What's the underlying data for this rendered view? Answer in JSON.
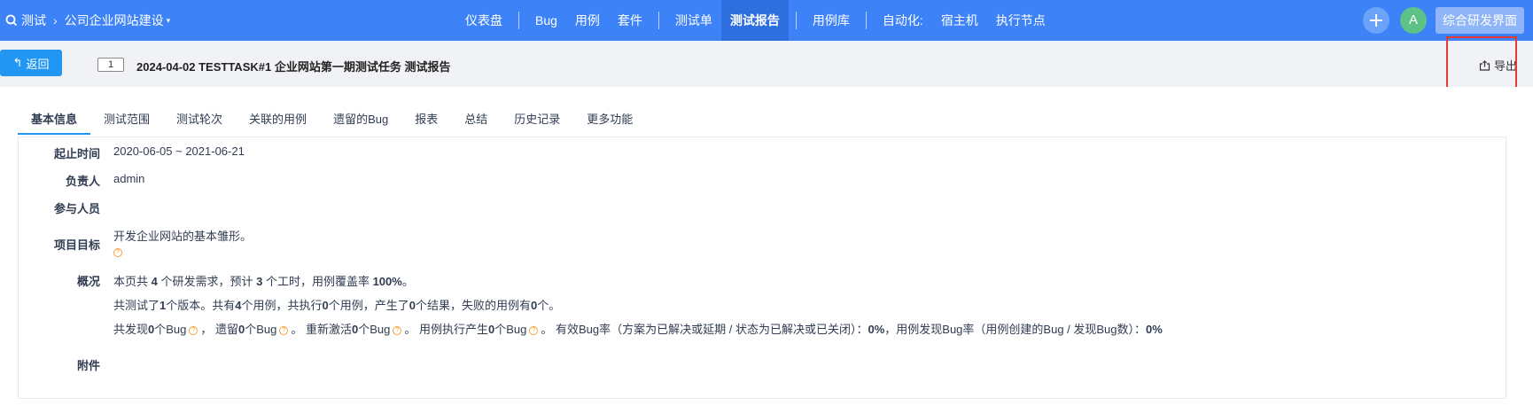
{
  "header": {
    "product": "测试",
    "project": "公司企业网站建设",
    "nav": [
      {
        "label": "仪表盘",
        "active": false
      },
      {
        "divider": true
      },
      {
        "label": "Bug",
        "active": false
      },
      {
        "label": "用例",
        "active": false
      },
      {
        "label": "套件",
        "active": false
      },
      {
        "divider": true
      },
      {
        "label": "测试单",
        "active": false
      },
      {
        "label": "测试报告",
        "active": true
      },
      {
        "divider": true
      },
      {
        "label": "用例库",
        "active": false
      },
      {
        "divider": true
      },
      {
        "label": "自动化:",
        "active": false
      },
      {
        "label": "宿主机",
        "active": false
      },
      {
        "label": "执行节点",
        "active": false
      }
    ],
    "avatar_letter": "A",
    "workspace_label": "综合研发界面"
  },
  "toolbar": {
    "back_label": "返回",
    "id_badge": "1",
    "title": "2024-04-02 TESTTASK#1 企业网站第一期测试任务 测试报告",
    "export_label": "导出"
  },
  "tabs": [
    "基本信息",
    "测试范围",
    "测试轮次",
    "关联的用例",
    "遗留的Bug",
    "报表",
    "总结",
    "历史记录",
    "更多功能"
  ],
  "info": {
    "period_label": "起止时间",
    "period_value": "2020-06-05 ~ 2021-06-21",
    "owner_label": "负责人",
    "owner_value": "admin",
    "members_label": "参与人员",
    "goal_label": "项目目标",
    "goal_value": "开发企业网站的基本雏形。",
    "overview_label": "概况",
    "overview_line1": {
      "pre": "本页共 ",
      "stories": "4",
      "mid1": " 个研发需求，预计 ",
      "hours": "3",
      "mid2": " 个工时，用例覆盖率 ",
      "coverage": "100%",
      "post": "。"
    },
    "overview_line2": {
      "p1": "共测试了",
      "builds": "1",
      "p2": "个版本。共有",
      "cases": "4",
      "p3": "个用例，共执行",
      "runs": "0",
      "p4": "个用例，产生了",
      "results": "0",
      "p5": "个结果，失败的用例有",
      "failed": "0",
      "p6": "个。"
    },
    "overview_line3": {
      "p1": "共发现",
      "found": "0",
      "p2": "个Bug",
      "p3": "， 遗留",
      "left": "0",
      "p4": "个Bug",
      "p5": "。 重新激活",
      "reopened": "0",
      "p6": "个Bug",
      "p7": "。 用例执行产生",
      "fromcase": "0",
      "p8": "个Bug",
      "p9": "。 有效Bug率（方案为已解决或延期 / 状态为已解决或已关闭）：",
      "effective_rate": "0%",
      "p10": "，用例发现Bug率（用例创建的Bug / 发现Bug数）：",
      "case_rate": "0%"
    },
    "attachments_label": "附件"
  },
  "colors": {
    "primary": "#3e82f7",
    "button": "#2196f3",
    "active_nav": "#2e6fe0",
    "highlight": "#e53935",
    "help_icon": "#f2a33a"
  }
}
